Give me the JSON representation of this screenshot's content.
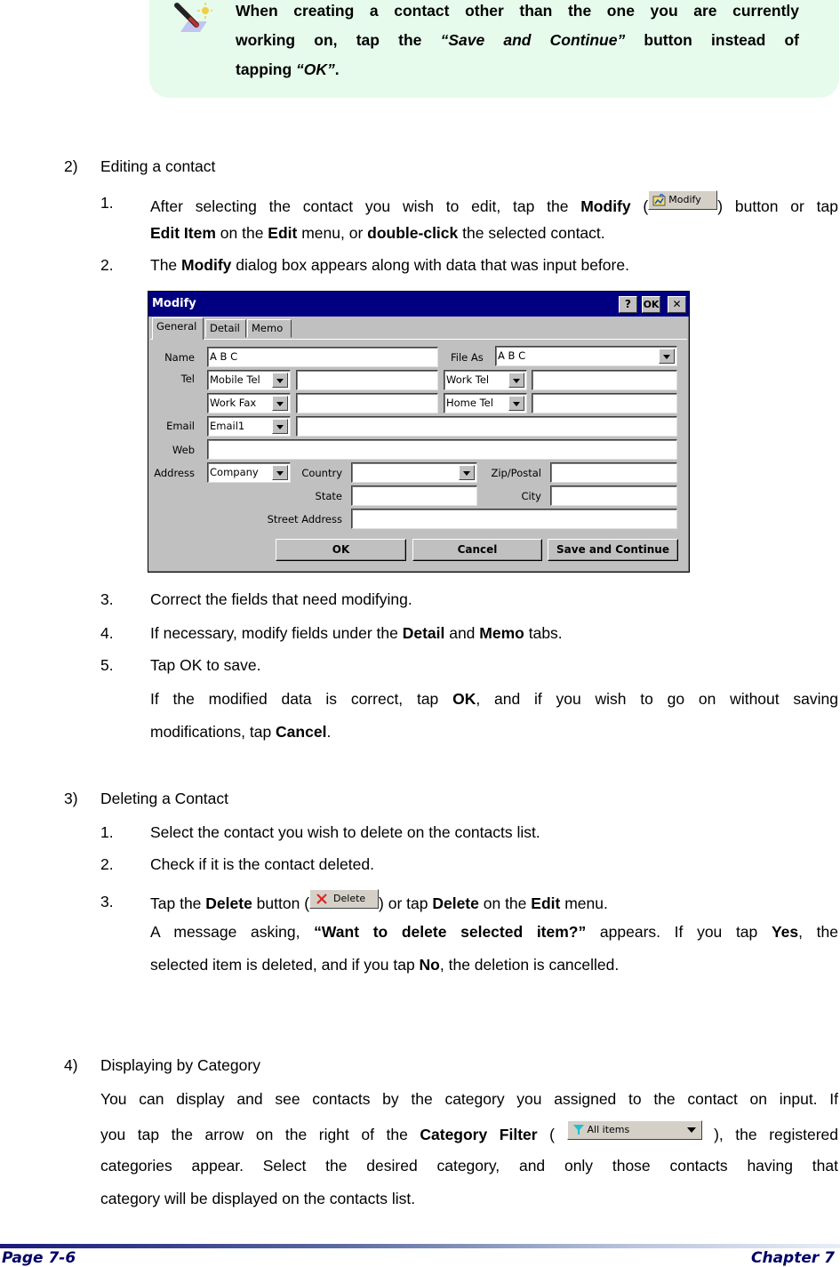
{
  "note": {
    "icon": "pen-note-icon",
    "line1": "When creating a contact other than the one you are currently",
    "line2_pre": "working on, tap the ",
    "line2_em": "“Save and Continue”",
    "line2_post": " button instead of",
    "line3_pre": "tapping ",
    "line3_em": "“OK”",
    "line3_post": "."
  },
  "sections": {
    "editing": {
      "num": "2)",
      "title": "Editing a contact",
      "steps": [
        {
          "num": "1.",
          "a": "After selecting the contact you wish to edit, tap the ",
          "b": "Modify",
          "c": " (",
          "d": ") button or tap"
        },
        {
          "a_b": "Edit Item",
          "a": " on the ",
          "b": "Edit",
          "c": " menu, or ",
          "d_b": "double-click",
          "e": " the selected contact."
        },
        {
          "num": "2.",
          "a": "The ",
          "b": "Modify",
          "c": " dialog box appears along with data that was input before."
        },
        {
          "num": "3.",
          "a": "Correct the fields that need modifying."
        },
        {
          "num": "4.",
          "a": "If necessary, modify fields under the ",
          "b": "Detail",
          "c": " and ",
          "d": "Memo",
          "e": " tabs."
        },
        {
          "num": "5.",
          "a": "Tap OK to save."
        },
        {
          "a": "If the modified data is correct, tap ",
          "b": "OK",
          "c": ", and if you wish to go on without saving"
        },
        {
          "a": "modifications, tap ",
          "b": "Cancel",
          "c": "."
        }
      ],
      "modify_button_label": "Modify"
    },
    "deleting": {
      "num": "3)",
      "title": "Deleting a Contact",
      "steps": [
        {
          "num": "1.",
          "a": "Select the contact you wish to delete on the contacts list."
        },
        {
          "num": "2.",
          "a": "Check if it is the contact deleted."
        },
        {
          "num": "3.",
          "a": "Tap the ",
          "b": "Delete",
          "c": " button (",
          "d": ") or tap ",
          "e": "Delete",
          "f": " on the ",
          "g": "Edit",
          "h": " menu."
        },
        {
          "a": "A message asking, ",
          "b": "“Want to delete selected item?”",
          "c": " appears. If you tap ",
          "d": "Yes",
          "e": ", the"
        },
        {
          "a": "selected item is deleted, and if you tap ",
          "b": "No",
          "c": ", the deletion is cancelled."
        }
      ],
      "delete_button_label": "Delete"
    },
    "category": {
      "num": "4)",
      "title": "Displaying by Category",
      "lines": [
        {
          "a": "You can display and see contacts by the category you assigned to the contact on input. If"
        },
        {
          "a": "you tap the arrow on the right of the ",
          "b": "Category Filter",
          "c": " ( ",
          "d": " ), the registered"
        },
        {
          "a": "categories appear. Select the desired category, and only those contacts having that"
        },
        {
          "a": "category will be displayed on the contacts list."
        }
      ],
      "filter_label": "All items"
    }
  },
  "dialog": {
    "title": "Modify",
    "title_buttons": {
      "help": "?",
      "ok": "OK",
      "close": "✕"
    },
    "tabs": [
      "General",
      "Detail",
      "Memo"
    ],
    "active_tab": "General",
    "labels": {
      "name": "Name",
      "file_as": "File As",
      "tel": "Tel",
      "email": "Email",
      "web": "Web",
      "address": "Address",
      "country": "Country",
      "zip": "Zip/Postal",
      "state": "State",
      "city": "City",
      "street": "Street Address"
    },
    "values": {
      "name": "A B C",
      "file_as": "A B C",
      "tel1_type": "Mobile Tel",
      "tel1": "",
      "tel2_type": "Work Tel",
      "tel2": "",
      "tel3_type": "Work Fax",
      "tel3": "",
      "tel4_type": "Home Tel",
      "tel4": "",
      "email_type": "Email1",
      "email": "",
      "web": "",
      "address_type": "Company",
      "country": "",
      "zip": "",
      "state": "",
      "city": "",
      "street": ""
    },
    "buttons": {
      "ok": "OK",
      "cancel": "Cancel",
      "save_continue": "Save and Continue"
    }
  },
  "footer": {
    "page": "Page 7-6",
    "chapter": "Chapter 7"
  }
}
